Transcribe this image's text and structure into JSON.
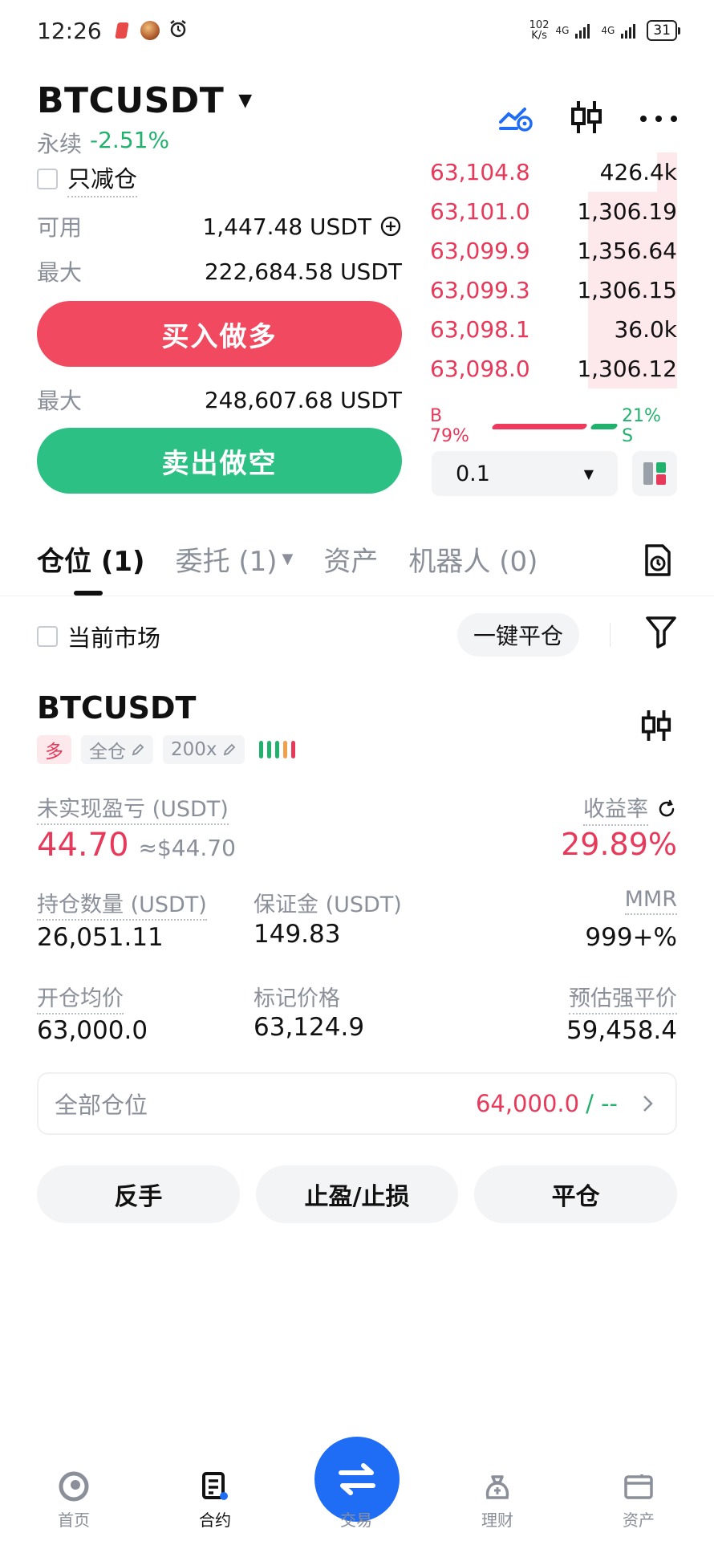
{
  "status_bar": {
    "time": "12:26",
    "net_speed_top": "102",
    "net_speed_unit": "K/s",
    "signal1": "4G",
    "signal2": "4G",
    "battery": "31"
  },
  "header": {
    "pair": "BTCUSDT",
    "contract_type": "永续",
    "change": "-2.51%"
  },
  "order_form": {
    "reduce_only": "只减仓",
    "available_label": "可用",
    "available_value": "1,447.48 USDT",
    "max_label": "最大",
    "max_buy_value": "222,684.58 USDT",
    "buy_button": "买入做多",
    "max_sell_label": "最大",
    "max_sell_value": "248,607.68 USDT",
    "sell_button": "卖出做空"
  },
  "order_book": {
    "asks": [
      {
        "price": "63,104.8",
        "qty": "426.4k",
        "depth": 0.08
      },
      {
        "price": "63,101.0",
        "qty": "1,306.19",
        "depth": 0.36
      },
      {
        "price": "63,099.9",
        "qty": "1,356.64",
        "depth": 0.36
      },
      {
        "price": "63,099.3",
        "qty": "1,306.15",
        "depth": 0.36
      },
      {
        "price": "63,098.1",
        "qty": "36.0k",
        "depth": 0.36
      },
      {
        "price": "63,098.0",
        "qty": "1,306.12",
        "depth": 0.36
      }
    ],
    "buy_ratio_label": "B 79%",
    "buy_ratio": 0.79,
    "sell_ratio_label": "21% S",
    "sell_ratio": 0.21,
    "qty_step": "0.1"
  },
  "tabs": [
    {
      "label": "仓位 (1)"
    },
    {
      "label": "委托 (1)"
    },
    {
      "label": "资产"
    },
    {
      "label": "机器人 (0)"
    }
  ],
  "filter_bar": {
    "current_market": "当前市场",
    "close_all": "一键平仓"
  },
  "position": {
    "symbol": "BTCUSDT",
    "side_tag": "多",
    "margin_tag": "全仓",
    "leverage_tag": "200x",
    "pnl_label": "未实现盈亏 (USDT)",
    "pnl_value": "44.70",
    "pnl_usd": "≈$44.70",
    "roe_label": "收益率",
    "roe_value": "29.89%",
    "size_label": "持仓数量 (USDT)",
    "size_value": "26,051.11",
    "margin_label": "保证金 (USDT)",
    "margin_value": "149.83",
    "mmr_label": "MMR",
    "mmr_value": "999+%",
    "entry_label": "开仓均价",
    "entry_value": "63,000.0",
    "mark_label": "标记价格",
    "mark_value": "63,124.9",
    "liq_label": "预估强平价",
    "liq_value": "59,458.4",
    "all_positions_label": "全部仓位",
    "all_positions_value": "64,000.0",
    "all_positions_sep": "/ --",
    "reverse_button": "反手",
    "tpsl_button": "止盈/止损",
    "close_button": "平仓"
  },
  "bottom_nav": [
    {
      "label": "首页"
    },
    {
      "label": "合约"
    },
    {
      "label": "交易"
    },
    {
      "label": "理财"
    },
    {
      "label": "资产"
    }
  ],
  "colors": {
    "red": "#e8395a",
    "green": "#20b26c",
    "blue": "#1f6cf5",
    "orange": "#f0a04b"
  }
}
